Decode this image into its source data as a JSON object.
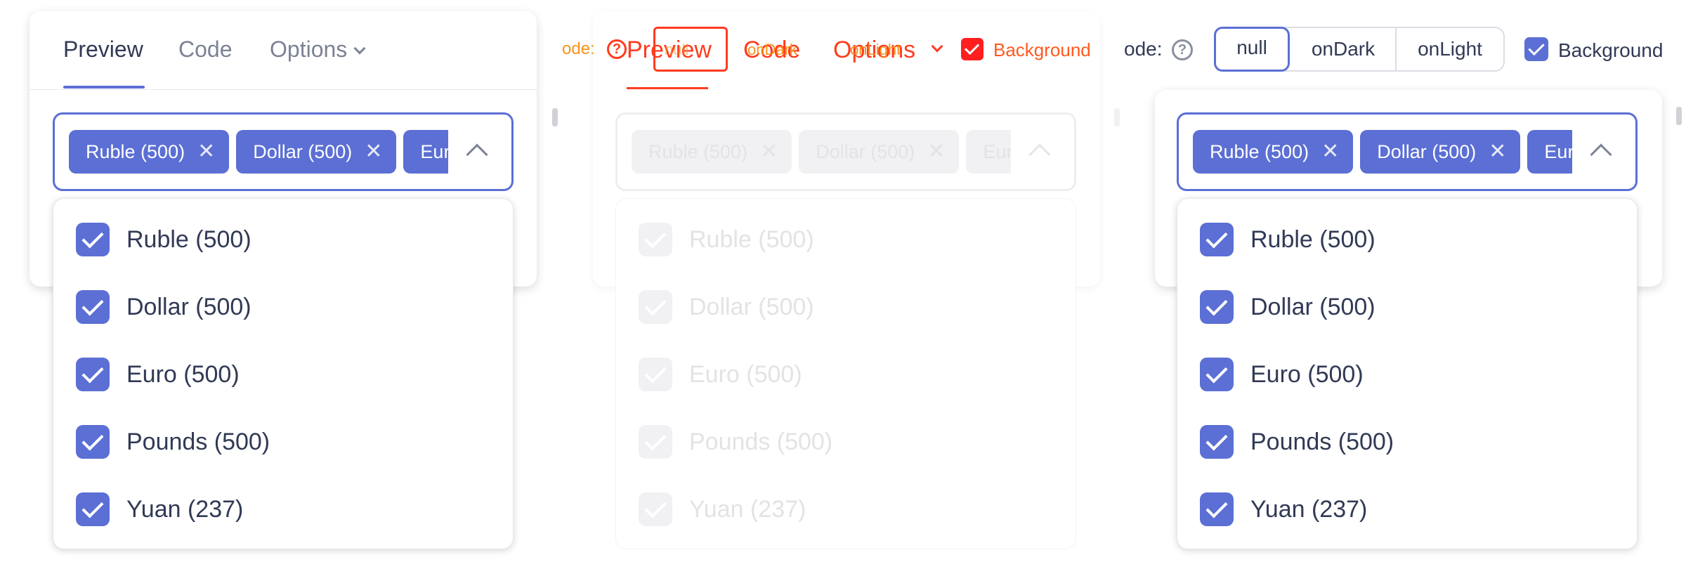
{
  "left": {
    "tabs": [
      {
        "label": "Preview",
        "active": true
      },
      {
        "label": "Code",
        "active": false
      },
      {
        "label": "Options",
        "active": false
      }
    ],
    "chips": [
      {
        "label": "Ruble (500)"
      },
      {
        "label": "Dollar (500)"
      },
      {
        "label": "Euro"
      }
    ],
    "options": [
      {
        "label": "Ruble (500)",
        "checked": true
      },
      {
        "label": "Dollar (500)",
        "checked": true
      },
      {
        "label": "Euro (500)",
        "checked": true
      },
      {
        "label": "Pounds (500)",
        "checked": true
      },
      {
        "label": "Yuan (237)",
        "checked": true
      }
    ]
  },
  "mid": {
    "overlay": {
      "mode_label": "ode:",
      "preview": "Preview",
      "code": "Code",
      "options": "Options",
      "null_label": "null",
      "ondark": "onDark",
      "onlight": "onLight",
      "background": "Background"
    },
    "chips": [
      {
        "label": "Ruble (500)"
      },
      {
        "label": "Dollar (500)"
      },
      {
        "label": "Euro"
      }
    ],
    "options": [
      {
        "label": "Ruble (500)"
      },
      {
        "label": "Dollar (500)"
      },
      {
        "label": "Euro (500)"
      },
      {
        "label": "Pounds (500)"
      },
      {
        "label": "Yuan (237)"
      }
    ]
  },
  "right": {
    "toolbar": {
      "mode_label": "ode:",
      "modes": [
        "null",
        "onDark",
        "onLight"
      ],
      "selected_mode": "null",
      "background_label": "Background",
      "background_checked": true
    },
    "chips": [
      {
        "label": "Ruble (500)"
      },
      {
        "label": "Dollar (500)"
      },
      {
        "label": "Euro"
      }
    ],
    "options": [
      {
        "label": "Ruble (500)",
        "checked": true
      },
      {
        "label": "Dollar (500)",
        "checked": true
      },
      {
        "label": "Euro (500)",
        "checked": true
      },
      {
        "label": "Pounds (500)",
        "checked": true
      },
      {
        "label": "Yuan (237)",
        "checked": true
      }
    ]
  },
  "colors": {
    "accent": "#5b6fd4",
    "overlay_red": "#ff3b1f",
    "overlay_orange": "#f7941d"
  }
}
